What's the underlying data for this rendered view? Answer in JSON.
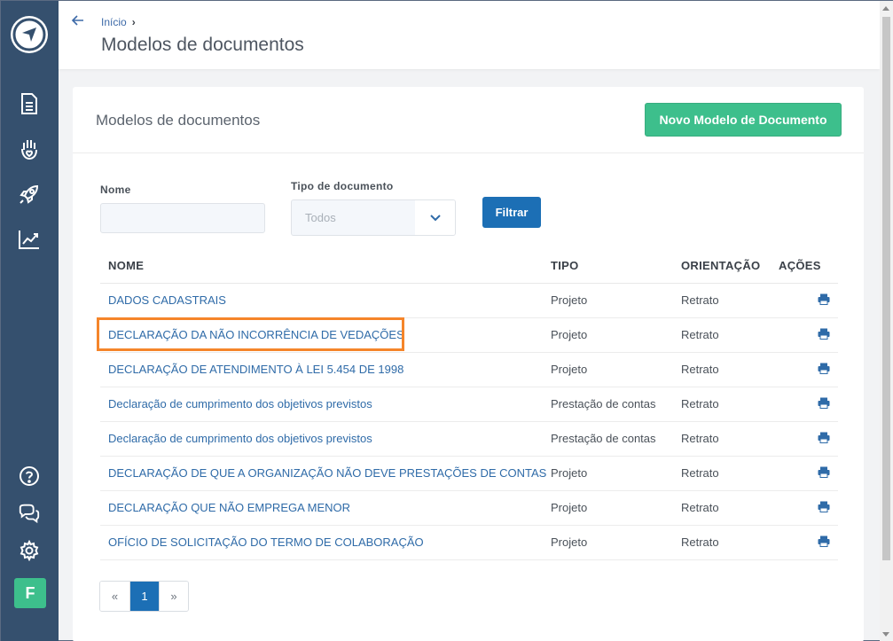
{
  "sidebar": {
    "icons": [
      "compass-logo-icon",
      "document-icon",
      "hand-heart-icon",
      "rocket-icon",
      "trend-chart-icon",
      "help-icon",
      "chat-icon",
      "gear-icon"
    ],
    "avatar_letter": "F",
    "bg_color": "#35506e"
  },
  "header": {
    "breadcrumb_home": "Início",
    "breadcrumb_sep": "›",
    "title": "Modelos de documentos"
  },
  "card": {
    "title": "Modelos de documentos",
    "new_button": "Novo Modelo de Documento"
  },
  "filters": {
    "nome_label": "Nome",
    "nome_value": "",
    "tipo_label": "Tipo de documento",
    "tipo_value": "Todos",
    "filter_button": "Filtrar"
  },
  "table": {
    "headers": {
      "nome": "NOME",
      "tipo": "TIPO",
      "orientacao": "ORIENTAÇÃO",
      "acoes": "AÇÕES"
    },
    "rows": [
      {
        "nome": "DADOS CADASTRAIS",
        "tipo": "Projeto",
        "orientacao": "Retrato"
      },
      {
        "nome": "DECLARAÇÃO DA NÃO INCORRÊNCIA DE VEDAÇÕES",
        "tipo": "Projeto",
        "orientacao": "Retrato"
      },
      {
        "nome": "DECLARAÇÃO DE ATENDIMENTO À LEI 5.454 DE 1998",
        "tipo": "Projeto",
        "orientacao": "Retrato"
      },
      {
        "nome": "Declaração de cumprimento dos objetivos previstos",
        "tipo": "Prestação de contas",
        "orientacao": "Retrato"
      },
      {
        "nome": "Declaração de cumprimento dos objetivos previstos",
        "tipo": "Prestação de contas",
        "orientacao": "Retrato"
      },
      {
        "nome": "DECLARAÇÃO DE QUE A ORGANIZAÇÃO NÃO DEVE PRESTAÇÕES DE CONTAS",
        "tipo": "Projeto",
        "orientacao": "Retrato"
      },
      {
        "nome": "DECLARAÇÃO QUE NÃO EMPREGA MENOR",
        "tipo": "Projeto",
        "orientacao": "Retrato"
      },
      {
        "nome": "OFÍCIO DE SOLICITAÇÃO DO TERMO DE COLABORAÇÃO",
        "tipo": "Projeto",
        "orientacao": "Retrato"
      }
    ],
    "action_icon": "print-icon"
  },
  "pagination": {
    "prev": "«",
    "current": "1",
    "next": "»"
  },
  "colors": {
    "accent_green": "#3dbf8c",
    "primary_blue": "#1c6fb5",
    "link_blue": "#2f6ba8",
    "highlight_orange": "#f5852a"
  }
}
